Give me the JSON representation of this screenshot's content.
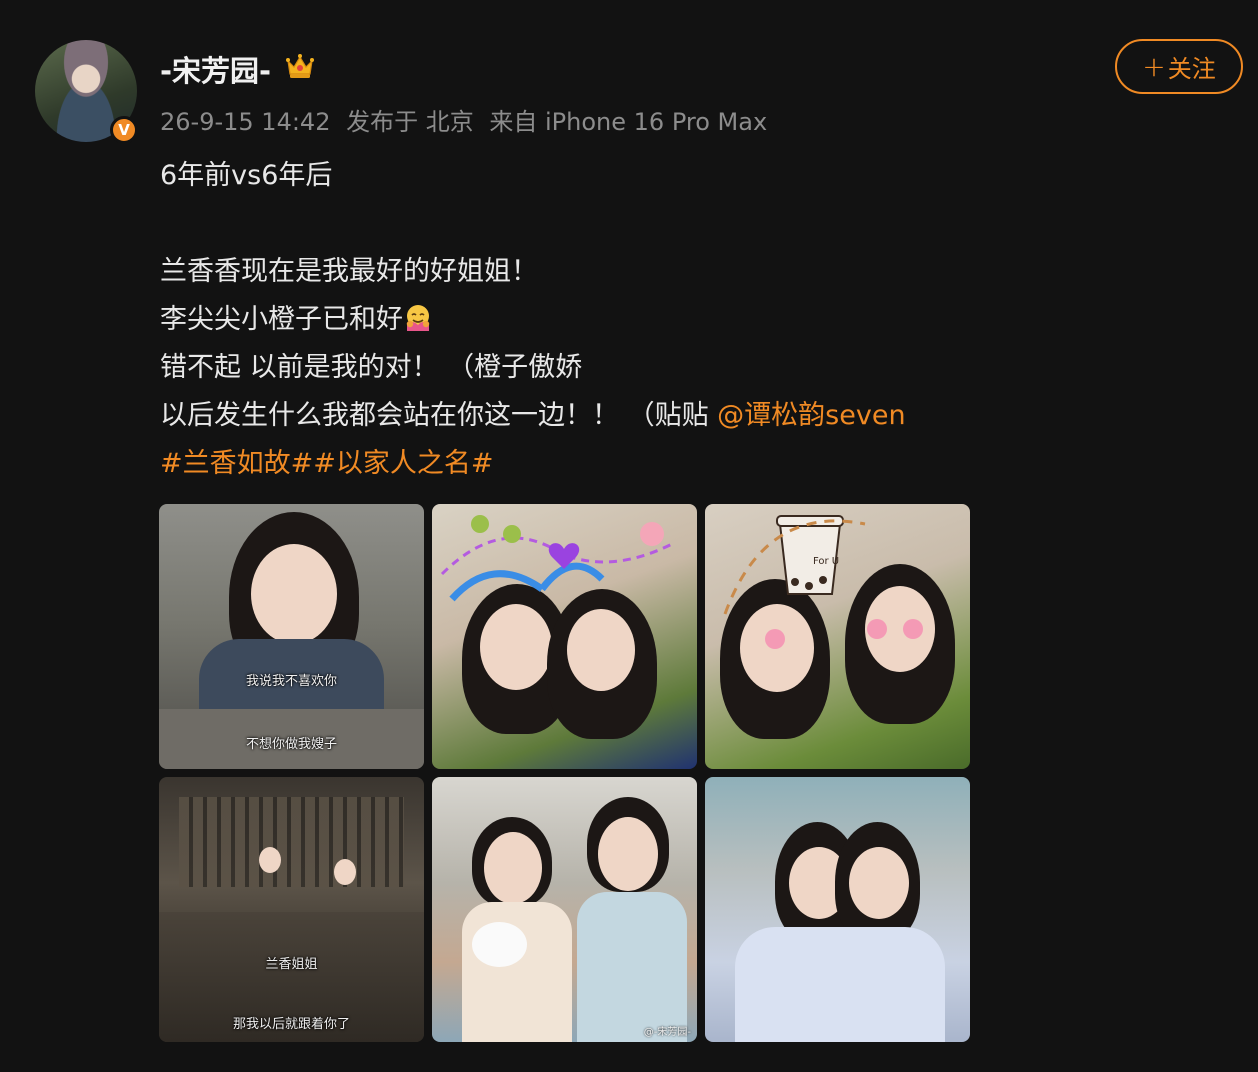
{
  "post": {
    "username": "-宋芳园-",
    "follow_label": "关注",
    "meta": {
      "time": "26-9-15 14:42",
      "location": "发布于 北京",
      "source": "来自 iPhone 16 Pro Max"
    },
    "content": {
      "line1": "6年前vs6年后",
      "line2": "兰香香现在是我最好的好姐姐！",
      "line3": "李尖尖小橙子已和好",
      "line4": "错不起 以前是我的对！ （橙子傲娇",
      "line5_text": "以后发生什么我都会站在你这一边！！ （贴贴 ",
      "line5_mention": "@谭松韵seven",
      "hashtags": "#兰香如故##以家人之名#"
    },
    "images": {
      "p1_cap1": "我说我不喜欢你",
      "p1_cap2": "不想你做我嫂子",
      "p3_cup": "For U",
      "p4_cap1": "兰香姐姐",
      "p4_cap2": "那我以后就跟着你了",
      "p5_watermark": "@-宋芳园-"
    }
  },
  "colors": {
    "accent": "#f08a24",
    "background": "#121212",
    "meta_text": "#8c8c8c"
  },
  "icons": [
    "crown-icon",
    "verified-badge-icon",
    "plus-icon",
    "hug-emoji-icon"
  ]
}
